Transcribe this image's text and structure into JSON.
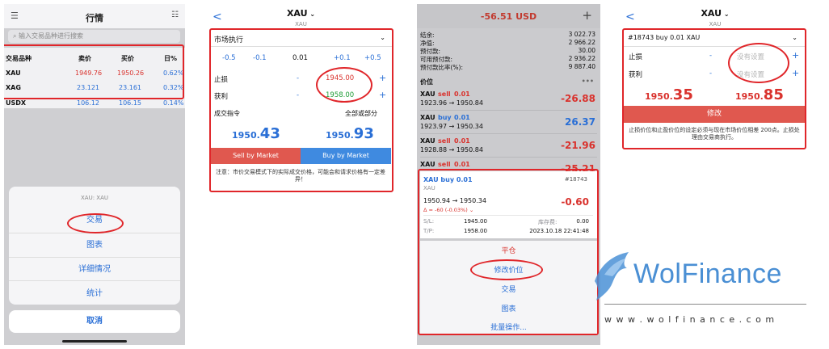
{
  "p1": {
    "title": "行情",
    "search_placeholder": "输入交易品种进行搜索",
    "cols": [
      "交易品种",
      "卖价",
      "买价",
      "日%"
    ],
    "rows": [
      {
        "sym": "XAU",
        "bid": "1949.76",
        "ask": "1950.26",
        "chg": "0.62%"
      },
      {
        "sym": "XAG",
        "bid": "23.121",
        "ask": "23.161",
        "chg": "0.32%"
      },
      {
        "sym": "USDX",
        "bid": "106.12",
        "ask": "106.15",
        "chg": "0.14%"
      }
    ],
    "sheet_title": "XAU: XAU",
    "actions": [
      "交易",
      "图表",
      "详细情况",
      "统计"
    ],
    "cancel": "取消"
  },
  "p2": {
    "title": "XAU",
    "sub": "XAU",
    "exec": "市场执行",
    "steps": [
      "-0.5",
      "-0.1",
      "0.01",
      "+0.1",
      "+0.5"
    ],
    "sl_label": "止损",
    "sl_value": "1945.00",
    "tp_label": "获利",
    "tp_value": "1958.00",
    "minus": "-",
    "plus": "+",
    "fill_label": "成交指令",
    "fill_value": "全部或部分",
    "bid_main": "1950.",
    "bid_big": "43",
    "ask_main": "1950.",
    "ask_big": "93",
    "sell_btn": "Sell by Market",
    "buy_btn": "Buy by Market",
    "note": "注意：市价交易模式下的实际成交价格，可能会和请求价格有一定差异！"
  },
  "p3": {
    "pl": "-56.51 USD",
    "acct": [
      {
        "k": "结余:",
        "v": "3 022.73"
      },
      {
        "k": "净值:",
        "v": "2 966.22"
      },
      {
        "k": "预付款:",
        "v": "30.00"
      },
      {
        "k": "可用预付款:",
        "v": "2 936.22"
      },
      {
        "k": "预付款比率(%):",
        "v": "9 887.40"
      }
    ],
    "section": "价位",
    "dots": "•••",
    "positions": [
      {
        "sym": "XAU",
        "side": "sell",
        "lot": "0.01",
        "px": "1923.96 → 1950.84",
        "pl": "-26.88"
      },
      {
        "sym": "XAU",
        "side": "buy",
        "lot": "0.01",
        "px": "1923.97 → 1950.34",
        "pl": "26.37"
      },
      {
        "sym": "XAU",
        "side": "sell",
        "lot": "0.01",
        "px": "1928.88 → 1950.84",
        "pl": "-21.96"
      },
      {
        "sym": "XAU",
        "side": "sell",
        "lot": "0.01",
        "px": "",
        "pl": "-25.21"
      }
    ],
    "sel": {
      "title": "XAU buy 0.01",
      "id": "#18743",
      "sub": "XAU",
      "px": "1950.94 → 1950.34",
      "pl": "-0.60",
      "delta": "Δ = -60 (-0.03%) ⌄",
      "sl_k": "S/L:",
      "sl_v": "1945.00",
      "sw_k": "库存费:",
      "sw_v": "0.00",
      "tp_k": "T/P:",
      "tp_v": "1958.00",
      "time": "2023.10.18 22:41:48"
    },
    "menu": [
      "平仓",
      "修改价位",
      "交易",
      "图表",
      "批量操作..."
    ]
  },
  "p4": {
    "title": "XAU",
    "sub": "XAU",
    "order": "#18743 buy 0.01 XAU",
    "sl_label": "止损",
    "tp_label": "获利",
    "unset": "没有设置",
    "minus": "-",
    "plus": "+",
    "bid_main": "1950.",
    "bid_big": "35",
    "ask_main": "1950.",
    "ask_big": "85",
    "modify": "修改",
    "note": "止损价位和止盈价位的设定必须与现在市场价位相差 200点。止损处理由交易商执行。"
  },
  "brand": {
    "name": "WolFinance",
    "url": "w w w . w o l f i n a n c e . c o m"
  }
}
